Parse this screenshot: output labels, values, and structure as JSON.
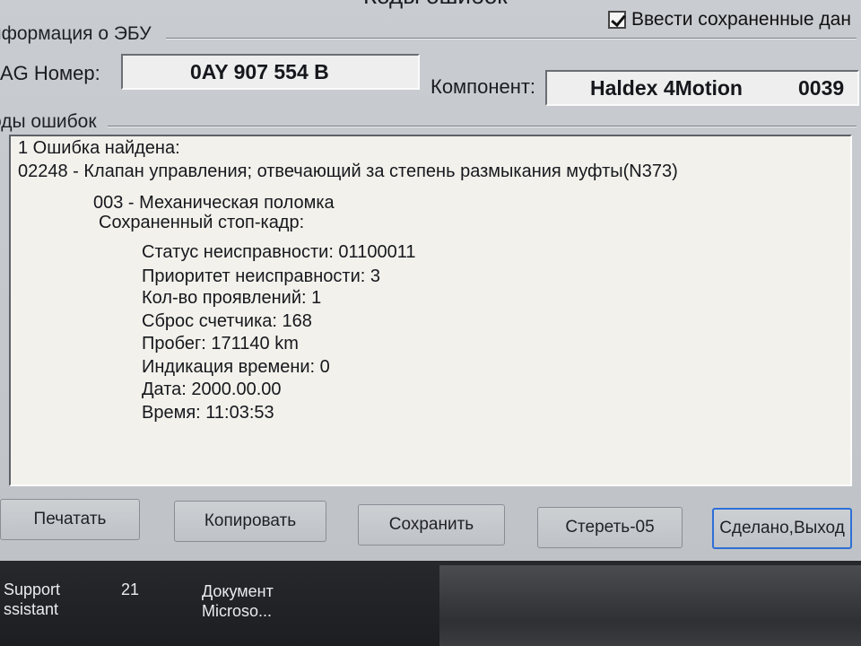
{
  "window": {
    "title": "Коды ошибок",
    "checkbox_label": "Ввести сохраненные дан",
    "checkbox_checked": true
  },
  "ecu_group": {
    "label": "нформация о ЭБУ",
    "vag_label": "AG Номер:",
    "vag_value": "0AY 907 554 B",
    "component_label": "Компонент:",
    "component_value": "Haldex 4Motion",
    "component_code": "0039"
  },
  "faults_group": {
    "label": "оды ошибок",
    "lines": [
      "1 Ошибка найдена:",
      "02248 - Клапан управления; отвечающий за степень размыкания муфты(N373)",
      "003 - Механическая поломка",
      "Сохраненный стоп-кадр:",
      "Статус неисправности: 01100011",
      "Приоритет неисправности: 3",
      "Кол-во проявлений: 1",
      "Сброс счетчика: 168",
      "Пробег: 171140 km",
      "Индикация времени: 0",
      "Дата: 2000.00.00",
      "Время: 11:03:53"
    ]
  },
  "buttons": {
    "print": "Печатать",
    "copy": "Копировать",
    "save": "Сохранить",
    "clear": "Стереть-05",
    "done": "Сделано,Выход"
  },
  "taskbar": {
    "item1_line1": "Support",
    "item1_line2": "ssistant",
    "item2": "21",
    "item3_line1": "Документ",
    "item3_line2": "Microso..."
  }
}
